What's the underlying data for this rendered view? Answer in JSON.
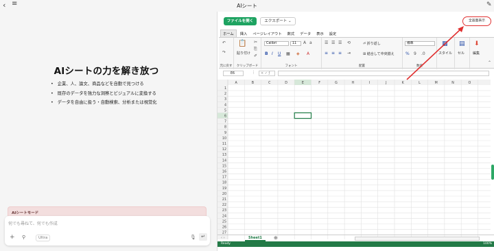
{
  "app": {
    "title": "AIシート"
  },
  "hero": {
    "heading": "AIシートの力を解き放つ",
    "bullets": [
      "企業、人、論文、商品などを自動で見つける",
      "既存のデータを強力な洞察とビジュアルに変換する",
      "データを自由に扱う・自動検索、分析または視覚化"
    ]
  },
  "chat": {
    "mode_label": "AIシートモード",
    "placeholder": "何でも尋ねて、何でも作成",
    "ultra_label": "Ultra"
  },
  "excel": {
    "open_button": "ファイルを開く",
    "export_button": "エクスポート",
    "fullscreen_button": "全画面表示",
    "tabs": [
      "ホーム",
      "挿入",
      "ページレイアウト",
      "数式",
      "データ",
      "表示",
      "設定"
    ],
    "active_tab": "ホーム",
    "ribbon": {
      "undo_label": "元に戻す",
      "paste_label": "貼り付け",
      "clipboard_label": "クリップボード",
      "font_name": "Calibri",
      "font_size": "11",
      "font_label": "フォント",
      "wrap_label": "折り返し",
      "merge_label": "結合して中央揃え",
      "align_label": "配置",
      "number_format": "標準",
      "number_label": "数値",
      "style_label": "スタイル",
      "cell_label": "セル",
      "edit_label": "編集"
    },
    "name_box": "E6",
    "columns": [
      "A",
      "B",
      "C",
      "D",
      "E",
      "F",
      "G",
      "H",
      "I",
      "J",
      "K",
      "L",
      "M",
      "N",
      "O"
    ],
    "rows": [
      "1",
      "2",
      "3",
      "4",
      "5",
      "6",
      "7",
      "8",
      "9",
      "10",
      "11",
      "12",
      "13",
      "14",
      "15",
      "16",
      "17",
      "18",
      "19",
      "20",
      "21",
      "22",
      "23",
      "24",
      "25",
      "26",
      "27"
    ],
    "selected_cell": "E6",
    "sheet_tab": "Sheet1",
    "status": "Ready",
    "zoom": "100%"
  },
  "colors": {
    "accent_green": "#1ea361",
    "status_green": "#237a47",
    "annotation_red": "#e03030"
  }
}
